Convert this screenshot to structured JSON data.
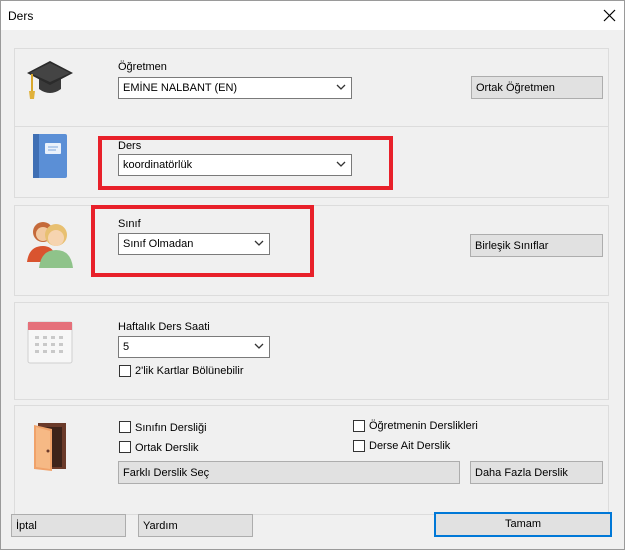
{
  "window": {
    "title": "Ders",
    "close_glyph": "×"
  },
  "teacher": {
    "label": "Öğretmen",
    "value": "EMİNE NALBANT (EN)",
    "co_teacher_button": "Ortak Öğretmen",
    "icon": "graduation-cap-icon"
  },
  "subject": {
    "label": "Ders",
    "value": "koordinatörlük",
    "icon": "notebook-icon"
  },
  "class": {
    "label": "Sınıf",
    "value": "Sınıf Olmadan",
    "joined_classes_button": "Birleşik Sınıflar",
    "icon": "people-icon"
  },
  "hours": {
    "label": "Haftalık Ders Saati",
    "value": "5",
    "double_cards_label": "2'lik Kartlar Bölünebilir",
    "double_cards_checked": false,
    "icon": "calendar-icon"
  },
  "rooms": {
    "icon": "door-icon",
    "class_room_label": "Sınıfın Dersliği",
    "class_room_checked": false,
    "teacher_rooms_label": "Öğretmenin Derslikleri",
    "teacher_rooms_checked": false,
    "shared_room_label": "Ortak Derslik",
    "shared_room_checked": false,
    "subject_room_label": "Derse Ait Derslik",
    "subject_room_checked": false,
    "choose_other_button": "Farklı Derslik Seç",
    "more_rooms_button": "Daha Fazla Derslik"
  },
  "footer": {
    "cancel_button": "İptal",
    "help_button": "Yardım",
    "ok_button": "Tamam"
  },
  "colors": {
    "highlight": "#e8202a",
    "accent": "#0078d7"
  }
}
